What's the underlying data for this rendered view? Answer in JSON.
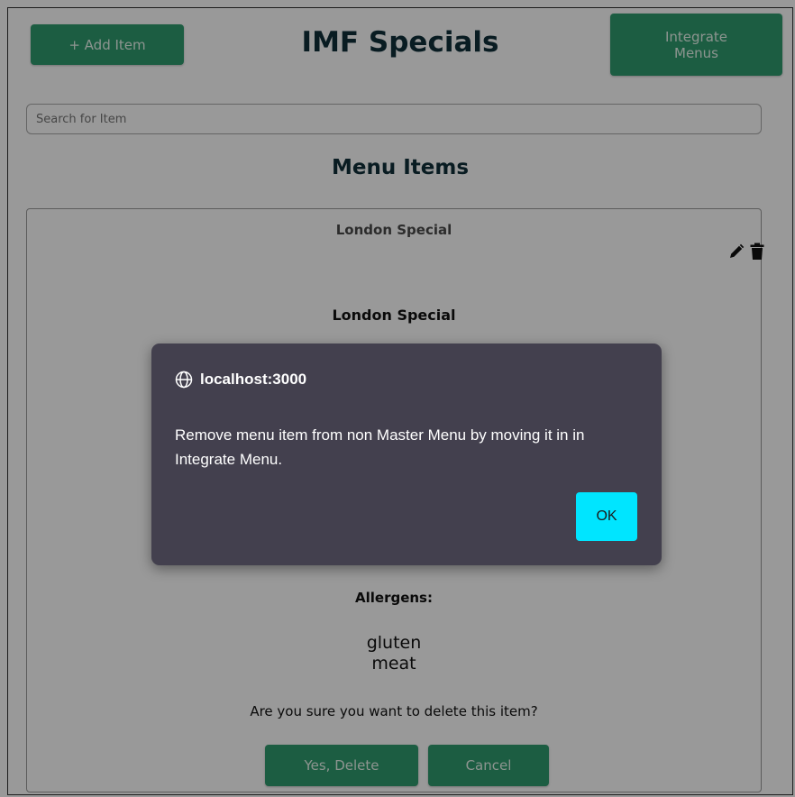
{
  "header": {
    "add_item_label": "+ Add Item",
    "title": "IMF Specials",
    "integrate_line1": "Integrate",
    "integrate_line2": "Menus"
  },
  "search": {
    "placeholder": "Search for Item"
  },
  "section_title": "Menu Items",
  "card": {
    "header": "London Special",
    "edit_icon": "pencil-icon",
    "delete_icon": "trash-icon",
    "item_name": "London Special",
    "allergens_label": "Allergens:",
    "allergens": [
      "gluten",
      "meat"
    ],
    "confirm_text": "Are you sure you want to delete this item?",
    "yes_delete_label": "Yes, Delete",
    "cancel_label": "Cancel"
  },
  "dialog": {
    "origin": "localhost:3000",
    "origin_icon": "globe-icon",
    "message": "Remove menu item from non Master Menu by moving it in in Integrate Menu.",
    "ok_label": "OK"
  },
  "colors": {
    "accent_green": "#2f9b6e",
    "title_color": "#0f2f3a",
    "dialog_bg": "#43404e",
    "ok_button": "#00e5ff"
  }
}
